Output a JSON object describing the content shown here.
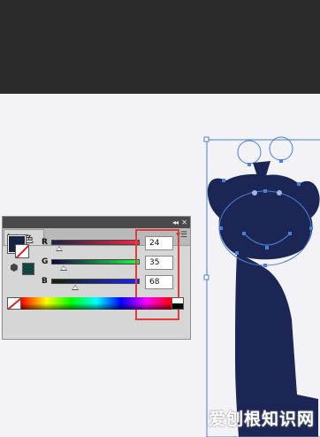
{
  "colors": {
    "fill": "#182344",
    "websafe": "#134547",
    "artwork": "#1c2654",
    "selection": "#4a7fd6",
    "highlight": "#e33c3c"
  },
  "panel": {
    "title": "颜色",
    "menu_icon": "panel-menu-icon",
    "collapse_icon": "collapse-icon",
    "close_icon": "close-icon",
    "channels": [
      {
        "label": "R",
        "value": "24",
        "level": 0.094
      },
      {
        "label": "G",
        "value": "35",
        "level": 0.137
      },
      {
        "label": "B",
        "value": "68",
        "level": 0.267
      }
    ]
  },
  "watermark": "爱刨根知识网"
}
